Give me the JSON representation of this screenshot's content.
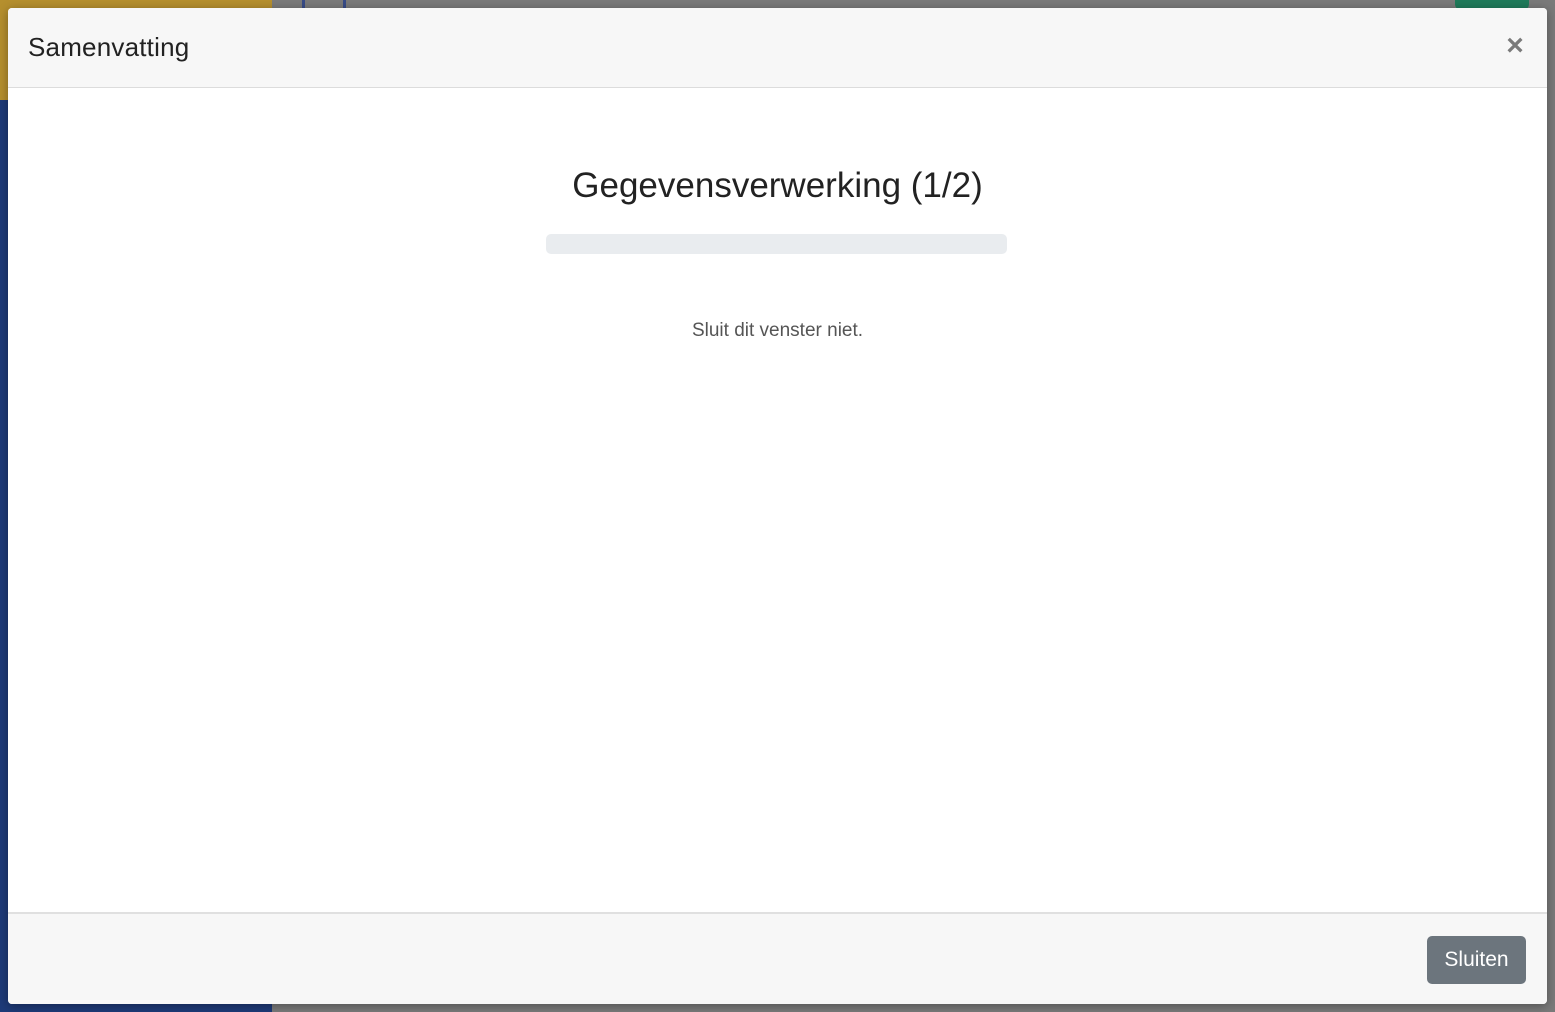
{
  "modal": {
    "title": "Samenvatting",
    "close_icon": "×",
    "step_title": "Gegevensverwerking (1/2)",
    "progress_percent": 0,
    "warning": "Sluit dit venster niet.",
    "close_button_label": "Sluiten"
  },
  "colors": {
    "accent": "#0d6efd",
    "secondary_button": "#6c757d"
  }
}
